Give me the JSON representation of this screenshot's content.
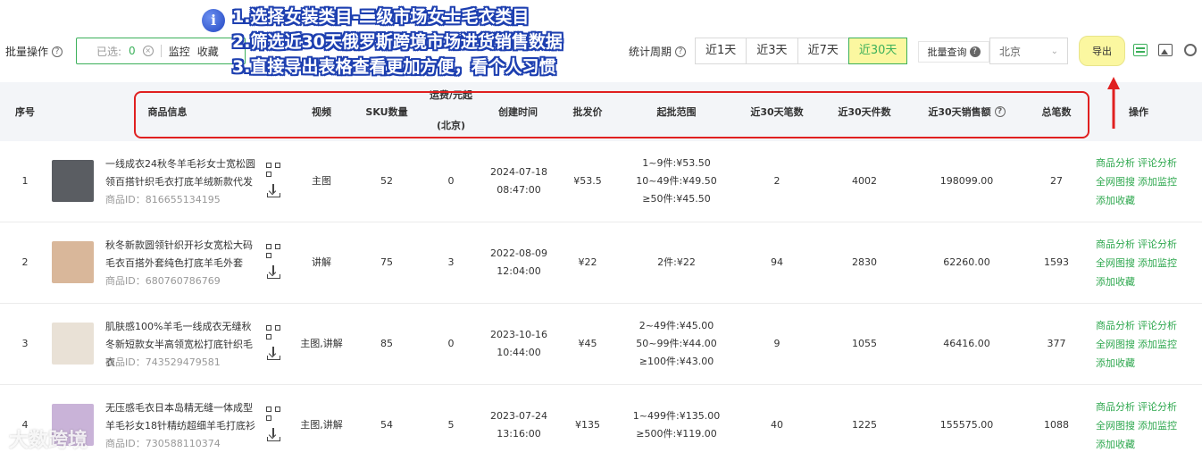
{
  "annotation": {
    "line1": "1.选择女装类目-二级市场女士毛衣类目",
    "line2": "2.筛选近30天俄罗斯跨境市场进货销售数据",
    "line3": "3.直接导出表格查看更加方便，看个人习惯"
  },
  "toolbar": {
    "batch_label": "批量操作",
    "selected_label": "已选:",
    "selected_count": "0",
    "monitor": "监控",
    "favorite": "收藏",
    "period_label": "统计周期",
    "periods": [
      "近1天",
      "近3天",
      "近7天",
      "近30天"
    ],
    "bulk_query": "批量查询",
    "city": "北京",
    "export": "导出"
  },
  "table": {
    "headers": {
      "index": "序号",
      "product": "商品信息",
      "video": "视频",
      "sku": "SKU数量",
      "ship_top": "运费/元起",
      "ship_bottom": "(北京)",
      "created": "创建时间",
      "price": "批发价",
      "range": "起批范围",
      "orders30": "近30天笔数",
      "pieces30": "近30天件数",
      "sales30": "近30天销售额",
      "total": "总笔数",
      "ops": "操作"
    },
    "rows": [
      {
        "index": "1",
        "title": "一线成衣24秋冬羊毛衫女士宽松圆领百搭针织毛衣打底羊绒新款代发",
        "pid": "商品ID：816655134195",
        "video": "主图",
        "sku": "52",
        "ship": "0",
        "date": "2024-07-18",
        "time": "08:47:00",
        "price": "¥53.5",
        "range": [
          "1~9件:¥53.50",
          "10~49件:¥49.50",
          "≥50件:¥45.50"
        ],
        "orders": "2",
        "pieces": "4002",
        "sales": "198099.00",
        "total": "27",
        "thumb_color": "#5a5d62"
      },
      {
        "index": "2",
        "title": "秋冬新款圆领针织开衫女宽松大码毛衣百搭外套纯色打底羊毛外套",
        "pid": "商品ID：680760786769",
        "video": "讲解",
        "sku": "75",
        "ship": "3",
        "date": "2022-08-09",
        "time": "12:04:00",
        "price": "¥22",
        "range": [
          "2件:¥22"
        ],
        "orders": "94",
        "pieces": "2830",
        "sales": "62260.00",
        "total": "1593",
        "thumb_color": "#d9b79a"
      },
      {
        "index": "3",
        "title": "肌肤感100%羊毛一线成衣无缝秋冬新短款女半高领宽松打底针织毛衣",
        "pid": "商品ID：743529479581",
        "video": "主图,讲解",
        "sku": "85",
        "ship": "0",
        "date": "2023-10-16",
        "time": "10:44:00",
        "price": "¥45",
        "range": [
          "2~49件:¥45.00",
          "50~99件:¥44.00",
          "≥100件:¥43.00"
        ],
        "orders": "9",
        "pieces": "1055",
        "sales": "46416.00",
        "total": "377",
        "thumb_color": "#e9e1d6"
      },
      {
        "index": "4",
        "title": "无压感毛衣日本岛精无缝一体成型羊毛衫女18针精纺超细羊毛打底衫",
        "pid": "商品ID：730588110374",
        "video": "主图,讲解",
        "sku": "54",
        "ship": "5",
        "date": "2023-07-24",
        "time": "13:16:00",
        "price": "¥135",
        "range": [
          "1~499件:¥135.00",
          "≥500件:¥119.00"
        ],
        "orders": "40",
        "pieces": "1225",
        "sales": "155575.00",
        "total": "1088",
        "thumb_color": "#c9b3d8"
      }
    ],
    "ops": [
      "商品分析",
      "评论分析",
      "全网图搜",
      "添加监控",
      "添加收藏"
    ]
  },
  "watermark": "大数跨境",
  "colors": {
    "accent": "#3bb05a",
    "highlight": "#fbf7a0",
    "annotation_red": "#e02020",
    "annotation_blue": "#1d3fb0"
  }
}
